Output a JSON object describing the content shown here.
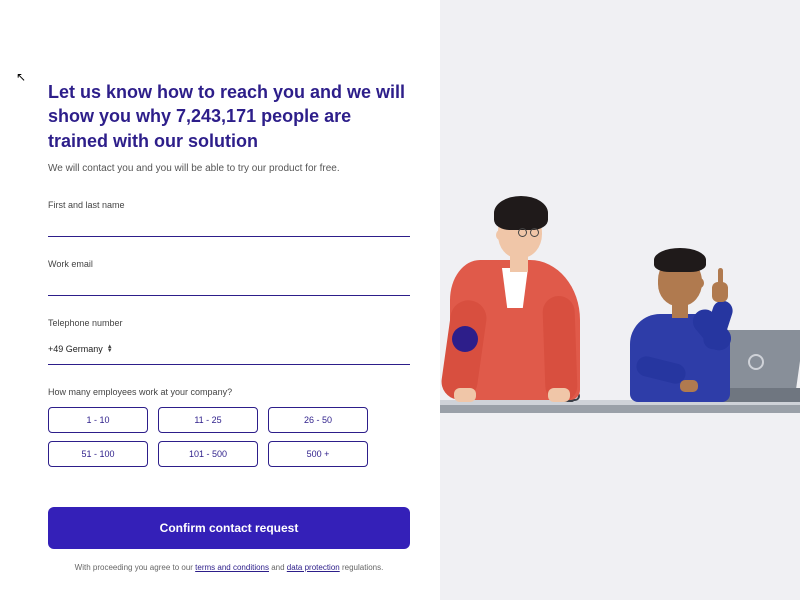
{
  "heading": "Let us know how to reach you and we will show you why 7,243,171 people are trained with our solution",
  "subtext": "We will contact you and you will be able to try our product for free.",
  "fields": {
    "name_label": "First and last name",
    "email_label": "Work email",
    "phone_label": "Telephone number",
    "phone_prefix": "+49 Germany"
  },
  "employees": {
    "label": "How many employees work at your company?",
    "options": [
      "1 - 10",
      "11 - 25",
      "26 - 50",
      "51 - 100",
      "101 - 500",
      "500 +"
    ]
  },
  "confirm_label": "Confirm contact request",
  "legal": {
    "pre": "With proceeding you agree to our ",
    "terms": "terms and conditions",
    "mid": " and ",
    "dp": "data protection",
    "post": " regulations."
  }
}
